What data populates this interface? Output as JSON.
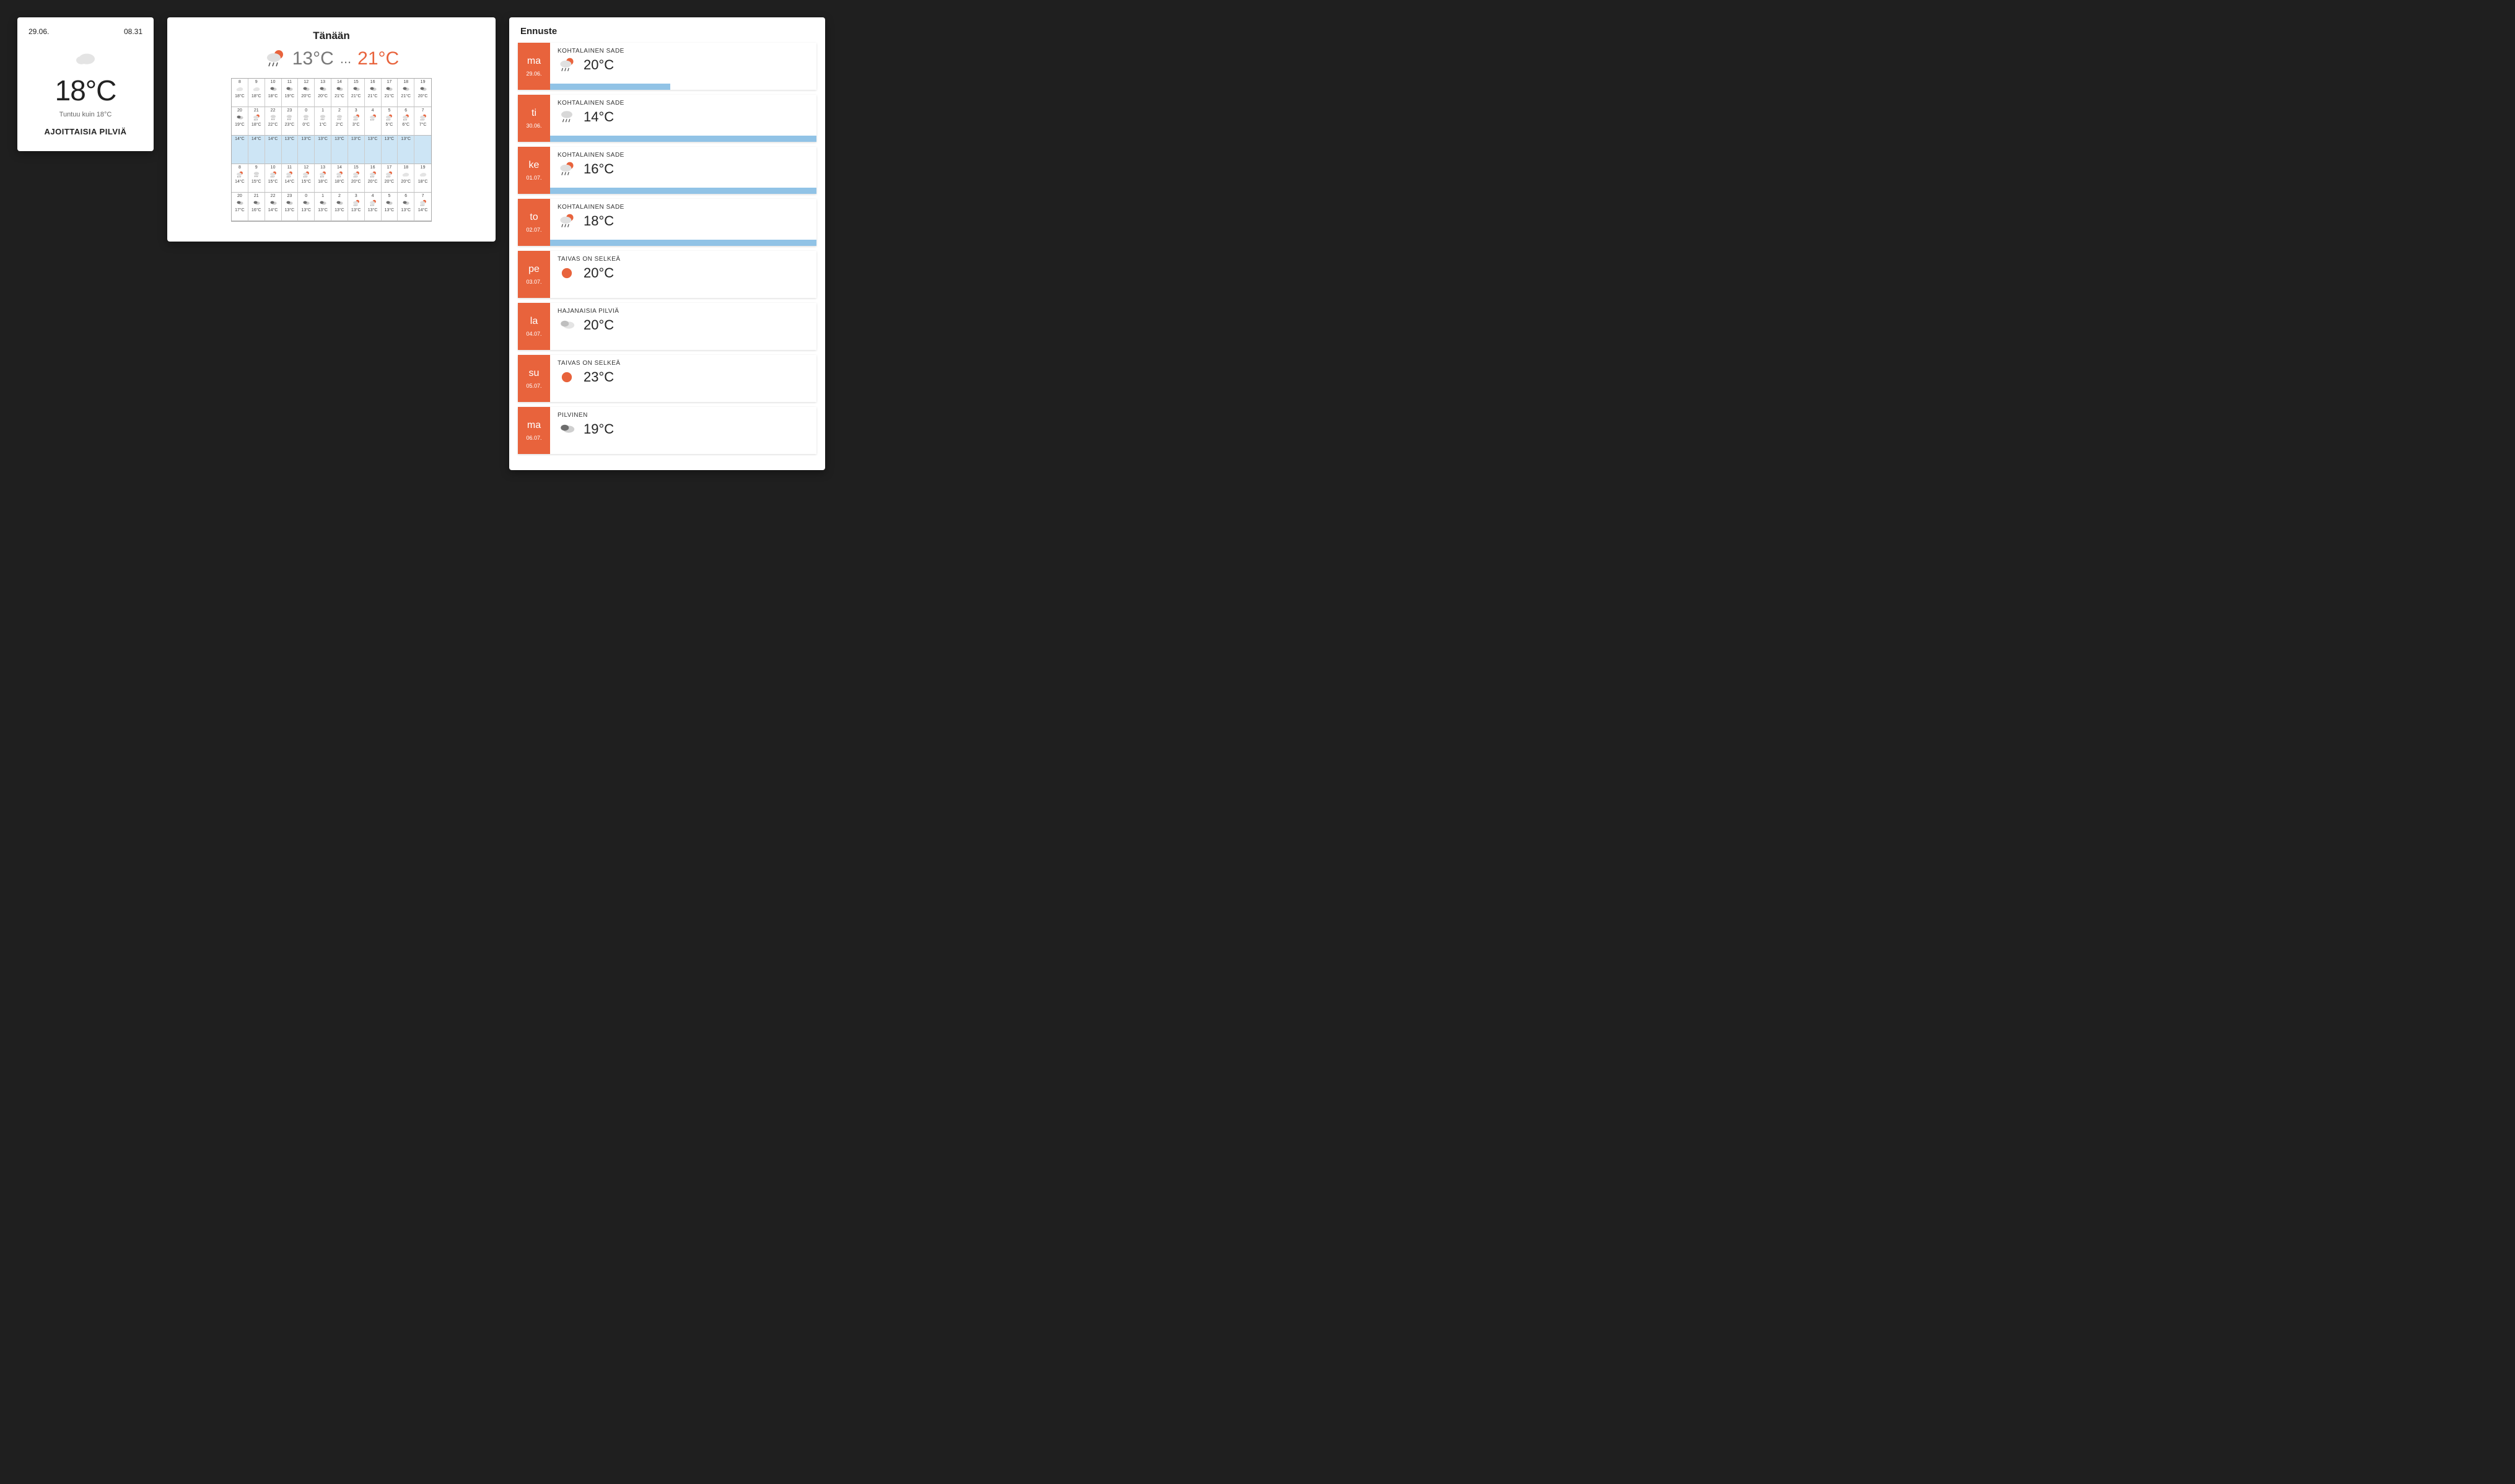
{
  "now": {
    "date": "29.06.",
    "time": "08.31",
    "icon": "cloud-light",
    "temp": "18°C",
    "feels_label": "Tuntuu kuin 18°C",
    "condition": "AJOITTAISIA PILVIÄ"
  },
  "today": {
    "title": "Tänään",
    "icon": "rain-sun",
    "low": "13°C",
    "dots": "...",
    "high": "21°C",
    "rows": [
      [
        {
          "h": "8",
          "t": "18°C",
          "i": "cloud-light"
        },
        {
          "h": "9",
          "t": "18°C",
          "i": "cloud-light"
        },
        {
          "h": "10",
          "t": "18°C",
          "i": "cloudy-dk"
        },
        {
          "h": "11",
          "t": "19°C",
          "i": "cloudy-dk"
        },
        {
          "h": "12",
          "t": "20°C",
          "i": "cloudy-dk"
        },
        {
          "h": "13",
          "t": "20°C",
          "i": "cloudy-dk"
        },
        {
          "h": "14",
          "t": "21°C",
          "i": "cloudy-dk"
        },
        {
          "h": "15",
          "t": "21°C",
          "i": "cloudy-dk"
        },
        {
          "h": "16",
          "t": "21°C",
          "i": "cloudy-dk"
        },
        {
          "h": "17",
          "t": "21°C",
          "i": "cloudy-dk"
        },
        {
          "h": "18",
          "t": "21°C",
          "i": "cloudy-dk"
        },
        {
          "h": "19",
          "t": "20°C",
          "i": "cloudy-dk"
        }
      ],
      [
        {
          "h": "20",
          "t": "19°C",
          "i": "cloudy-dk"
        },
        {
          "h": "21",
          "t": "18°C",
          "i": "rain-sun"
        },
        {
          "h": "22",
          "t": "22°C",
          "i": "rain"
        },
        {
          "h": "23",
          "t": "23°C",
          "i": "rain"
        },
        {
          "h": "0",
          "t": "0°C",
          "i": "rain"
        },
        {
          "h": "1",
          "t": "1°C",
          "i": "rain"
        },
        {
          "h": "2",
          "t": "2°C",
          "i": "rain"
        },
        {
          "h": "3",
          "t": "3°C",
          "i": "rain-sun"
        },
        {
          "h": "4",
          "t": "",
          "i": "rain-sun"
        },
        {
          "h": "5",
          "t": "5°C",
          "i": "rain-sun"
        },
        {
          "h": "6",
          "t": "6°C",
          "i": "rain-sun"
        },
        {
          "h": "7",
          "t": "7°C",
          "i": "rain-sun"
        }
      ],
      [
        {
          "h": "",
          "t": "14°C",
          "i": "",
          "band": true
        },
        {
          "h": "",
          "t": "14°C",
          "i": "",
          "band": true
        },
        {
          "h": "",
          "t": "14°C",
          "i": "",
          "band": true
        },
        {
          "h": "",
          "t": "13°C",
          "i": "",
          "band": true
        },
        {
          "h": "",
          "t": "13°C",
          "i": "",
          "band": true
        },
        {
          "h": "",
          "t": "13°C",
          "i": "",
          "band": true
        },
        {
          "h": "",
          "t": "13°C",
          "i": "",
          "band": true
        },
        {
          "h": "",
          "t": "13°C",
          "i": "",
          "band": true,
          "sel": true
        },
        {
          "h": "",
          "t": "13°C",
          "i": "",
          "band": true
        },
        {
          "h": "",
          "t": "13°C",
          "i": "",
          "band": true
        },
        {
          "h": "",
          "t": "13°C",
          "i": "",
          "band": true
        },
        {
          "h": "",
          "t": "",
          "i": "",
          "band": true
        }
      ],
      [
        {
          "h": "8",
          "t": "14°C",
          "i": "rain-sun"
        },
        {
          "h": "9",
          "t": "15°C",
          "i": "rain"
        },
        {
          "h": "10",
          "t": "15°C",
          "i": "rain-sun"
        },
        {
          "h": "11",
          "t": "14°C",
          "i": "rain-sun"
        },
        {
          "h": "12",
          "t": "15°C",
          "i": "rain-sun"
        },
        {
          "h": "13",
          "t": "18°C",
          "i": "rain-sun"
        },
        {
          "h": "14",
          "t": "18°C",
          "i": "rain-sun"
        },
        {
          "h": "15",
          "t": "20°C",
          "i": "rain-sun"
        },
        {
          "h": "16",
          "t": "20°C",
          "i": "rain-sun"
        },
        {
          "h": "17",
          "t": "20°C",
          "i": "rain-sun"
        },
        {
          "h": "18",
          "t": "20°C",
          "i": "cloud-light"
        },
        {
          "h": "19",
          "t": "18°C",
          "i": "cloud-light"
        }
      ],
      [
        {
          "h": "20",
          "t": "17°C",
          "i": "cloudy-dk"
        },
        {
          "h": "21",
          "t": "16°C",
          "i": "cloudy-dk"
        },
        {
          "h": "22",
          "t": "14°C",
          "i": "cloudy-dk"
        },
        {
          "h": "23",
          "t": "13°C",
          "i": "cloudy-dk"
        },
        {
          "h": "0",
          "t": "13°C",
          "i": "cloudy-dk"
        },
        {
          "h": "1",
          "t": "13°C",
          "i": "cloudy-dk"
        },
        {
          "h": "2",
          "t": "13°C",
          "i": "cloudy-dk"
        },
        {
          "h": "3",
          "t": "13°C",
          "i": "rain-sun"
        },
        {
          "h": "4",
          "t": "13°C",
          "i": "rain-sun"
        },
        {
          "h": "5",
          "t": "13°C",
          "i": "cloudy-dk"
        },
        {
          "h": "6",
          "t": "13°C",
          "i": "cloudy-dk"
        },
        {
          "h": "7",
          "t": "14°C",
          "i": "rain-sun"
        }
      ]
    ]
  },
  "forecast": {
    "title": "Ennuste",
    "items": [
      {
        "dw": "ma",
        "dt": "29.06.",
        "cond": "KOHTALAINEN SADE",
        "temp": "20°C",
        "icon": "rain-sun",
        "bar": 45
      },
      {
        "dw": "ti",
        "dt": "30.06.",
        "cond": "KOHTALAINEN SADE",
        "temp": "14°C",
        "icon": "rain",
        "bar": 100
      },
      {
        "dw": "ke",
        "dt": "01.07.",
        "cond": "KOHTALAINEN SADE",
        "temp": "16°C",
        "icon": "rain-sun",
        "bar": 100
      },
      {
        "dw": "to",
        "dt": "02.07.",
        "cond": "KOHTALAINEN SADE",
        "temp": "18°C",
        "icon": "rain-sun",
        "bar": 100
      },
      {
        "dw": "pe",
        "dt": "03.07.",
        "cond": "TAIVAS ON SELKEÄ",
        "temp": "20°C",
        "icon": "sun",
        "bar": 0
      },
      {
        "dw": "la",
        "dt": "04.07.",
        "cond": "HAJANAISIA PILVIÄ",
        "temp": "20°C",
        "icon": "cloudy",
        "bar": 0
      },
      {
        "dw": "su",
        "dt": "05.07.",
        "cond": "TAIVAS ON SELKEÄ",
        "temp": "23°C",
        "icon": "sun",
        "bar": 0
      },
      {
        "dw": "ma",
        "dt": "06.07.",
        "cond": "PILVINEN",
        "temp": "19°C",
        "icon": "cloudy-dk",
        "bar": 0
      }
    ]
  }
}
